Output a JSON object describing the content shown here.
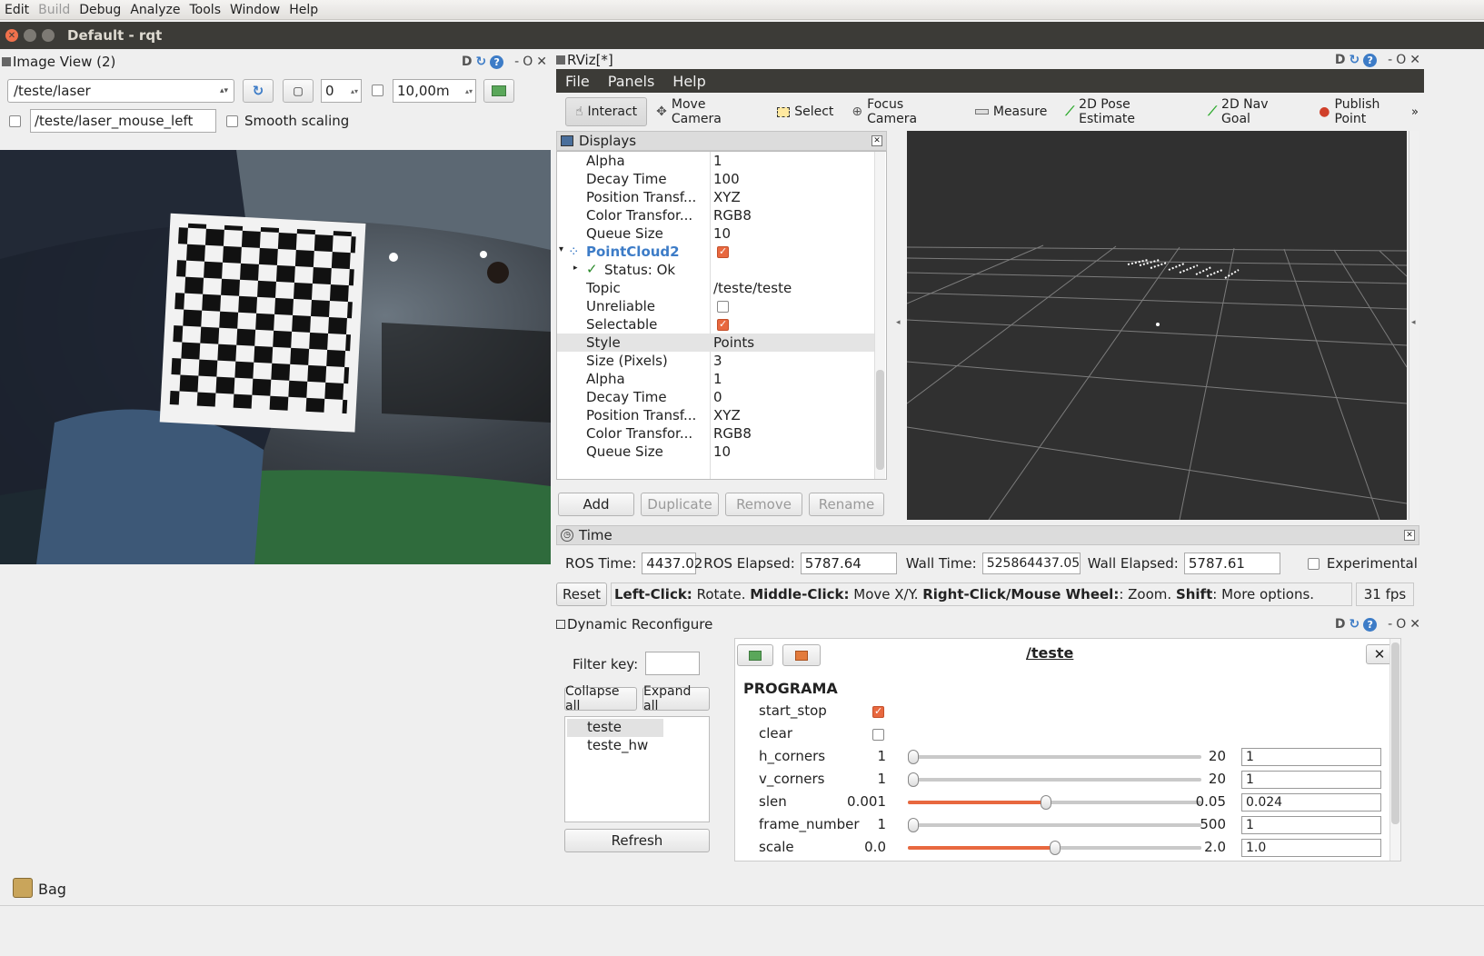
{
  "menubar": {
    "items": [
      "Edit",
      "Build",
      "Debug",
      "Analyze",
      "Tools",
      "Window",
      "Help"
    ]
  },
  "window": {
    "title": "Default - rqt"
  },
  "image_view": {
    "title": "Image View (2)",
    "topic": "/teste/laser",
    "spin_value": "0",
    "range_value": "10,00m",
    "mouse_topic": "/teste/laser_mouse_left",
    "smooth_label": "Smooth scaling"
  },
  "rviz": {
    "title": "RViz[*]",
    "menu": [
      "File",
      "Panels",
      "Help"
    ],
    "tools": [
      "Interact",
      "Move Camera",
      "Select",
      "Focus Camera",
      "Measure",
      "2D Pose Estimate",
      "2D Nav Goal",
      "Publish Point"
    ],
    "displays": {
      "title": "Displays",
      "rows": [
        {
          "k": "Alpha",
          "v": "1"
        },
        {
          "k": "Decay Time",
          "v": "100"
        },
        {
          "k": "Position Transf...",
          "v": "XYZ"
        },
        {
          "k": "Color Transfor...",
          "v": "RGB8"
        },
        {
          "k": "Queue Size",
          "v": "10"
        },
        {
          "k": "PointCloud2",
          "v": ""
        },
        {
          "k": "Status: Ok",
          "v": ""
        },
        {
          "k": "Topic",
          "v": "/teste/teste"
        },
        {
          "k": "Unreliable",
          "v": ""
        },
        {
          "k": "Selectable",
          "v": ""
        },
        {
          "k": "Style",
          "v": "Points"
        },
        {
          "k": "Size (Pixels)",
          "v": "3"
        },
        {
          "k": "Alpha",
          "v": "1"
        },
        {
          "k": "Decay Time",
          "v": "0"
        },
        {
          "k": "Position Transf...",
          "v": "XYZ"
        },
        {
          "k": "Color Transfor...",
          "v": "RGB8"
        },
        {
          "k": "Queue Size",
          "v": "10"
        }
      ],
      "buttons": [
        "Add",
        "Duplicate",
        "Remove",
        "Rename"
      ]
    },
    "time": {
      "title": "Time",
      "ros_time_label": "ROS Time:",
      "ros_time": "4437.02",
      "ros_elapsed_label": "ROS Elapsed:",
      "ros_elapsed": "5787.64",
      "wall_time_label": "Wall Time:",
      "wall_time": "525864437.05",
      "wall_elapsed_label": "Wall Elapsed:",
      "wall_elapsed": "5787.61",
      "experimental": "Experimental"
    },
    "status": {
      "reset": "Reset",
      "left_click": "Left-Click:",
      "left_click_text": " Rotate. ",
      "middle_click": "Middle-Click:",
      "middle_click_text": " Move X/Y. ",
      "right_click": "Right-Click/Mouse Wheel:",
      "right_click_text": ": Zoom. ",
      "shift": "Shift",
      "shift_text": ": More options.",
      "fps": "31 fps"
    }
  },
  "dynreconf": {
    "title": "Dynamic Reconfigure",
    "filter_label": "Filter key:",
    "collapse": "Collapse all",
    "expand": "Expand all",
    "nodes": [
      "teste",
      "teste_hw"
    ],
    "refresh": "Refresh",
    "node_title": "/teste",
    "group": "PROGRAMA",
    "params": [
      {
        "name": "start_stop",
        "type": "bool",
        "checked": true
      },
      {
        "name": "clear",
        "type": "bool",
        "checked": false
      },
      {
        "name": "h_corners",
        "type": "slider",
        "min": "1",
        "max": "20",
        "value": "1",
        "fraction": 0.0
      },
      {
        "name": "v_corners",
        "type": "slider",
        "min": "1",
        "max": "20",
        "value": "1",
        "fraction": 0.0
      },
      {
        "name": "slen",
        "type": "slider",
        "min": "0.001",
        "max": "0.05",
        "value": "0.024",
        "fraction": 0.47
      },
      {
        "name": "frame_number",
        "type": "slider",
        "min": "1",
        "max": "500",
        "value": "1",
        "fraction": 0.0
      },
      {
        "name": "scale",
        "type": "slider",
        "min": "0.0",
        "max": "2.0",
        "value": "1.0",
        "fraction": 0.5
      }
    ]
  },
  "bag": {
    "label": "Bag"
  },
  "colors": {
    "accent": "#e8683f",
    "dark_bar": "#3c3b37",
    "link_blue": "#3d7cc7"
  }
}
